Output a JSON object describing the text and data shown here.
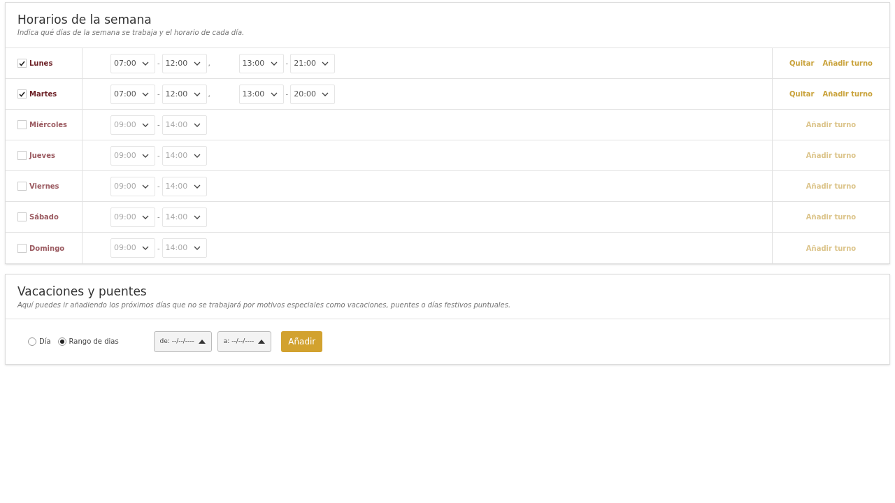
{
  "schedule": {
    "title": "Horarios de la semana",
    "subtitle": "Indica qué días de la semana se trabaja y el horario de cada día.",
    "days": [
      {
        "label": "Lunes",
        "checked": true,
        "shifts": [
          {
            "from": "07:00",
            "dash": "-",
            "to": "12:00"
          },
          {
            "lead": ",",
            "from": "13:00",
            "dash": "-",
            "to": "21:00"
          }
        ],
        "actions": [
          "Quitar",
          "Añadir turno"
        ]
      },
      {
        "label": "Martes",
        "checked": true,
        "shifts": [
          {
            "from": "07:00",
            "dash": "-",
            "to": "12:00"
          },
          {
            "lead": ",",
            "from": "13:00",
            "dash": "-",
            "to": "20:00"
          }
        ],
        "actions": [
          "Quitar",
          "Añadir turno"
        ]
      },
      {
        "label": "Miércoles",
        "checked": false,
        "shifts": [
          {
            "from": "09:00",
            "dash": "-",
            "to": "14:00"
          }
        ],
        "actions": [
          "Añadir turno"
        ]
      },
      {
        "label": "Jueves",
        "checked": false,
        "shifts": [
          {
            "from": "09:00",
            "dash": "-",
            "to": "14:00"
          }
        ],
        "actions": [
          "Añadir turno"
        ]
      },
      {
        "label": "Viernes",
        "checked": false,
        "shifts": [
          {
            "from": "09:00",
            "dash": "-",
            "to": "14:00"
          }
        ],
        "actions": [
          "Añadir turno"
        ]
      },
      {
        "label": "Sábado",
        "checked": false,
        "shifts": [
          {
            "from": "09:00",
            "dash": "-",
            "to": "14:00"
          }
        ],
        "actions": [
          "Añadir turno"
        ]
      },
      {
        "label": "Domingo",
        "checked": false,
        "shifts": [
          {
            "from": "09:00",
            "dash": "-",
            "to": "14:00"
          }
        ],
        "actions": [
          "Añadir turno"
        ]
      }
    ]
  },
  "holidays": {
    "title": "Vacaciones y puentes",
    "subtitle": "Aquí puedes ir añadiendo los próximos días que no se trabajará por motivos especiales como vacaciones, puentes o días festivos puntuales.",
    "modes": [
      {
        "label": "Día",
        "selected": false
      },
      {
        "label": "Rango de dias",
        "selected": true
      }
    ],
    "date_fields": [
      "de: --/--/----",
      "a: --/--/----"
    ],
    "button": "Añadir"
  }
}
